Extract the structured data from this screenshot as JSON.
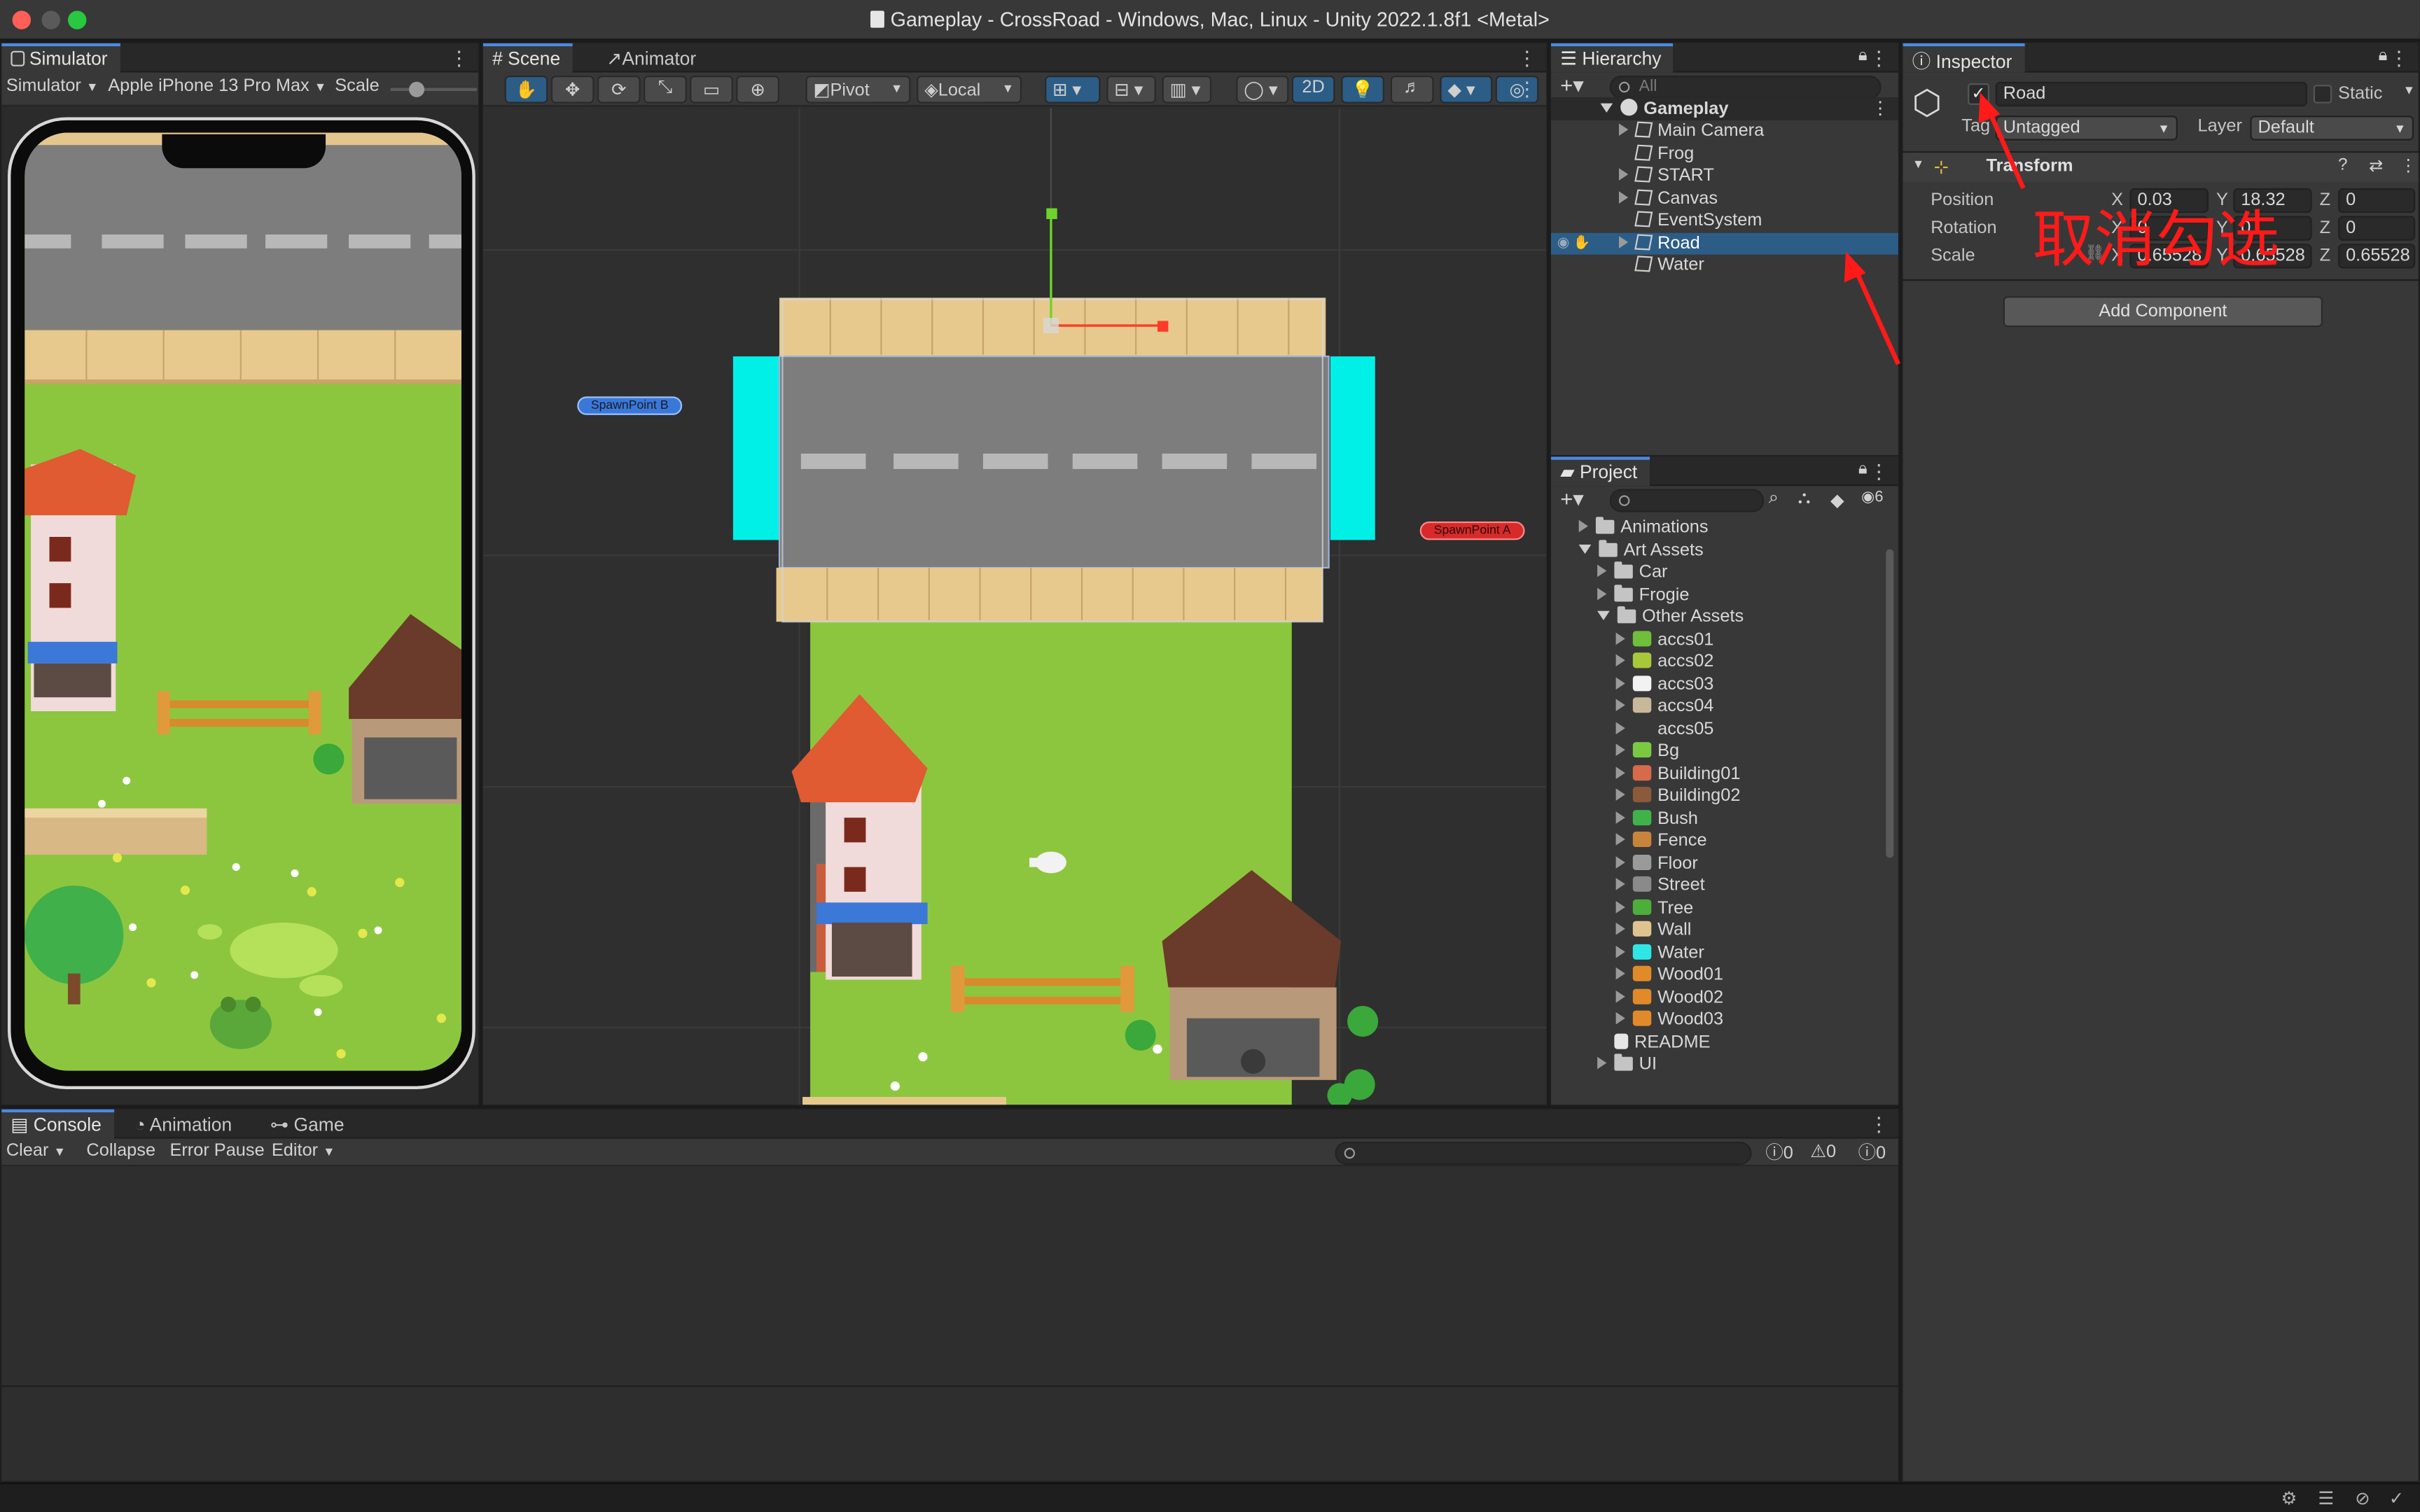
{
  "window": {
    "title": "Gameplay - CrossRoad - Windows, Mac, Linux - Unity 2022.1.8f1 <Metal>"
  },
  "simulator": {
    "tab": "Simulator",
    "mode": "Simulator",
    "device": "Apple iPhone 13 Pro Max",
    "scale_label": "Scale"
  },
  "scene": {
    "tabs": [
      "Scene",
      "Animator"
    ],
    "pivot": "Pivot",
    "local": "Local",
    "mode_2d": "2D",
    "spawn_b": "SpawnPoint B",
    "spawn_a": "SpawnPoint A"
  },
  "hierarchy": {
    "tab": "Hierarchy",
    "search_placeholder": "All",
    "root": "Gameplay",
    "items": [
      {
        "label": "Main Camera",
        "expandable": true,
        "selected": false
      },
      {
        "label": "Frog",
        "expandable": false,
        "selected": false
      },
      {
        "label": "START",
        "expandable": true,
        "selected": false
      },
      {
        "label": "Canvas",
        "expandable": true,
        "selected": false
      },
      {
        "label": "EventSystem",
        "expandable": false,
        "selected": false
      },
      {
        "label": "Road",
        "expandable": true,
        "selected": true
      },
      {
        "label": "Water",
        "expandable": false,
        "selected": false
      }
    ]
  },
  "project": {
    "tab": "Project",
    "hidden_count": "6",
    "tree": [
      {
        "label": "Animations",
        "depth": 0,
        "kind": "folder",
        "arrow": "right"
      },
      {
        "label": "Art Assets",
        "depth": 0,
        "kind": "folder",
        "arrow": "down"
      },
      {
        "label": "Car",
        "depth": 1,
        "kind": "folder",
        "arrow": "right"
      },
      {
        "label": "Frogie",
        "depth": 1,
        "kind": "folder",
        "arrow": "right"
      },
      {
        "label": "Other Assets",
        "depth": 1,
        "kind": "folder",
        "arrow": "down"
      },
      {
        "label": "accs01",
        "depth": 2,
        "kind": "asset",
        "color": "#6fbf3a",
        "arrow": "right"
      },
      {
        "label": "accs02",
        "depth": 2,
        "kind": "asset",
        "color": "#a8c83c",
        "arrow": "right"
      },
      {
        "label": "accs03",
        "depth": 2,
        "kind": "asset",
        "color": "#f2f2f2",
        "arrow": "right"
      },
      {
        "label": "accs04",
        "depth": 2,
        "kind": "asset",
        "color": "#c8b89a",
        "arrow": "right"
      },
      {
        "label": "accs05",
        "depth": 2,
        "kind": "asset",
        "color": "#383838",
        "arrow": "right"
      },
      {
        "label": "Bg",
        "depth": 2,
        "kind": "asset",
        "color": "#7ac943",
        "arrow": "right"
      },
      {
        "label": "Building01",
        "depth": 2,
        "kind": "asset",
        "color": "#d66a4a",
        "arrow": "right"
      },
      {
        "label": "Building02",
        "depth": 2,
        "kind": "asset",
        "color": "#8a5a3a",
        "arrow": "right"
      },
      {
        "label": "Bush",
        "depth": 2,
        "kind": "asset",
        "color": "#3fb34a",
        "arrow": "right"
      },
      {
        "label": "Fence",
        "depth": 2,
        "kind": "asset",
        "color": "#c8843a",
        "arrow": "right"
      },
      {
        "label": "Floor",
        "depth": 2,
        "kind": "asset",
        "color": "#9a9a9a",
        "arrow": "right"
      },
      {
        "label": "Street",
        "depth": 2,
        "kind": "asset",
        "color": "#8a8a8a",
        "arrow": "right"
      },
      {
        "label": "Tree",
        "depth": 2,
        "kind": "asset",
        "color": "#4caf3a",
        "arrow": "right"
      },
      {
        "label": "Wall",
        "depth": 2,
        "kind": "asset",
        "color": "#e0c490",
        "arrow": "right"
      },
      {
        "label": "Water",
        "depth": 2,
        "kind": "asset",
        "color": "#2ee6e6",
        "arrow": "right"
      },
      {
        "label": "Wood01",
        "depth": 2,
        "kind": "asset",
        "color": "#e08a2a",
        "arrow": "right"
      },
      {
        "label": "Wood02",
        "depth": 2,
        "kind": "asset",
        "color": "#e08a2a",
        "arrow": "right"
      },
      {
        "label": "Wood03",
        "depth": 2,
        "kind": "asset",
        "color": "#e08a2a",
        "arrow": "right"
      },
      {
        "label": "README",
        "depth": 1,
        "kind": "doc",
        "arrow": "none"
      },
      {
        "label": "UI",
        "depth": 1,
        "kind": "folder",
        "arrow": "right"
      }
    ]
  },
  "inspector": {
    "tab": "Inspector",
    "object_name": "Road",
    "static_label": "Static",
    "tag_label": "Tag",
    "tag_value": "Untagged",
    "layer_label": "Layer",
    "layer_value": "Default",
    "transform_title": "Transform",
    "position_label": "Position",
    "rotation_label": "Rotation",
    "scale_label": "Scale",
    "position": {
      "x": "0.03",
      "y": "18.32",
      "z": "0"
    },
    "rotation": {
      "x": "0",
      "y": "0",
      "z": "0"
    },
    "scale": {
      "x": "0.65528",
      "y": "0.65528",
      "z": "0.65528"
    },
    "axis_x": "X",
    "axis_y": "Y",
    "axis_z": "Z",
    "add_component": "Add Component",
    "annotation_text": "取消勾选"
  },
  "bottom": {
    "tabs": [
      "Console",
      "Animation",
      "Game"
    ],
    "clear": "Clear",
    "collapse": "Collapse",
    "error_pause": "Error Pause",
    "editor": "Editor",
    "count_info": "0",
    "count_warn": "0",
    "count_error": "0"
  },
  "colors": {
    "accent": "#2c5d87",
    "annotation_red": "#ff1a1a",
    "water_cyan": "#00f0e8",
    "grass": "#8cc63f"
  }
}
